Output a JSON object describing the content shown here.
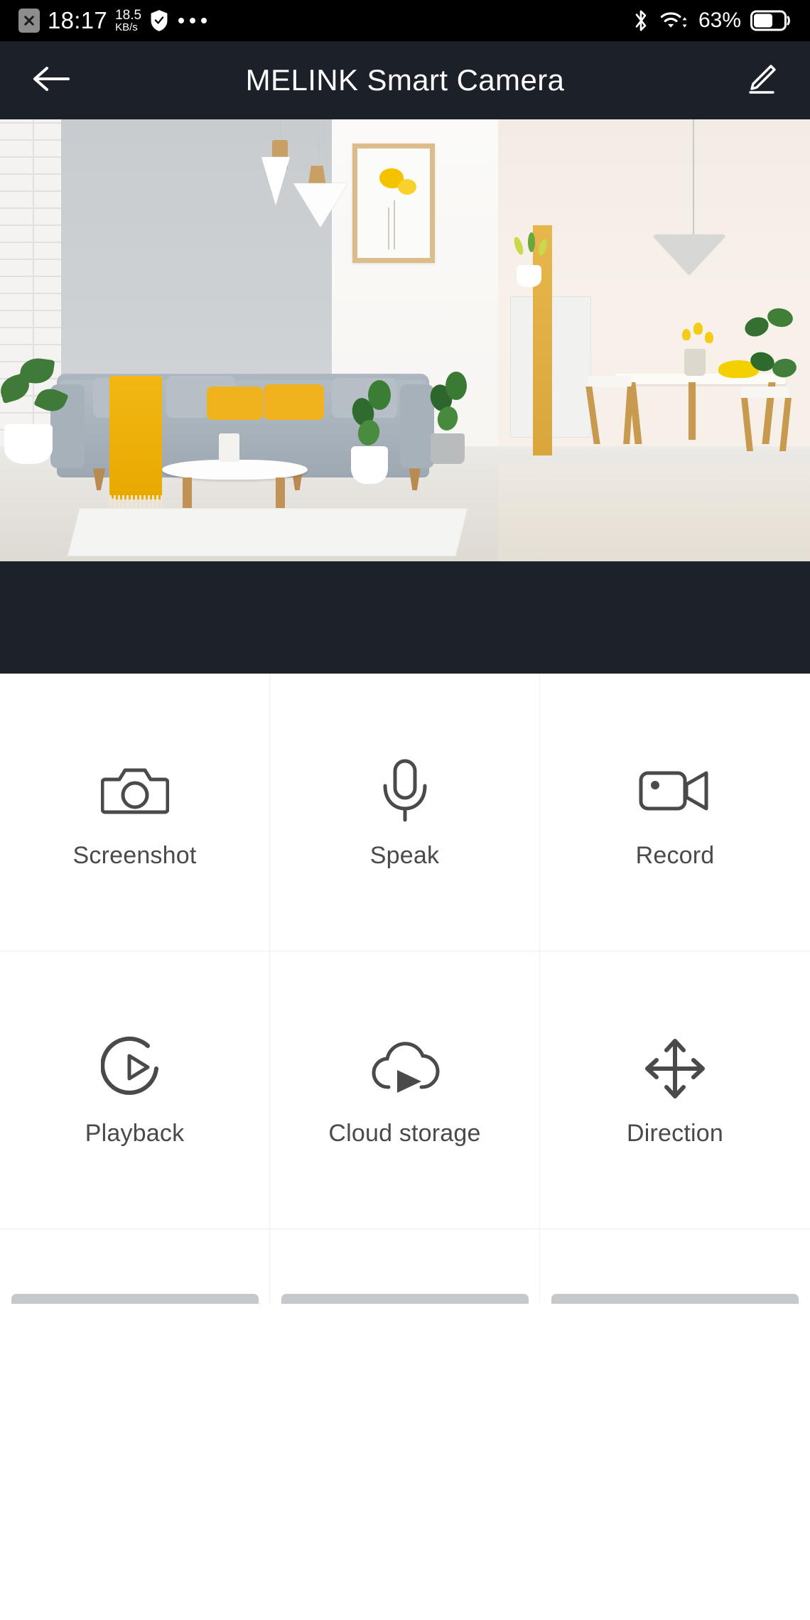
{
  "status_bar": {
    "sim_icon": "sim-card-off-icon",
    "time": "18:17",
    "network_speed_value": "18.5",
    "network_speed_unit": "KB/s",
    "shield_icon": "shield-check-icon",
    "more_icon": "more-dots-icon",
    "bluetooth_icon": "bluetooth-icon",
    "wifi_icon": "wifi-icon",
    "battery_percent": "63%",
    "battery_icon": "battery-icon",
    "background_color": "#000000",
    "foreground_color": "#ffffff"
  },
  "app_bar": {
    "back_icon": "back-arrow-icon",
    "title": "MELINK Smart Camera",
    "edit_icon": "pencil-edit-icon",
    "background_color": "#1b2029",
    "text_color": "#ffffff"
  },
  "video": {
    "scene_description": "Live camera feed of a modern living room with a gray sofa, yellow throw and cushions, pendant lamps, framed yellow flower art, potted plants, and a wooden dining table with yellow tulips and lemons",
    "letterbox_color": "#1d2128"
  },
  "controls": {
    "rows": [
      [
        {
          "icon": "camera-icon",
          "label": "Screenshot"
        },
        {
          "icon": "microphone-icon",
          "label": "Speak"
        },
        {
          "icon": "video-camera-icon",
          "label": "Record"
        }
      ],
      [
        {
          "icon": "playback-circle-play-icon",
          "label": "Playback"
        },
        {
          "icon": "cloud-play-icon",
          "label": "Cloud storage"
        },
        {
          "icon": "four-direction-arrows-icon",
          "label": "Direction"
        }
      ]
    ],
    "icon_color": "#4a4a4a",
    "label_color": "#4a4a4a",
    "divider_color": "#f0f0f0",
    "background_color": "#ffffff"
  },
  "loading_placeholders": {
    "count": 3,
    "color": "#c6c9cc"
  }
}
